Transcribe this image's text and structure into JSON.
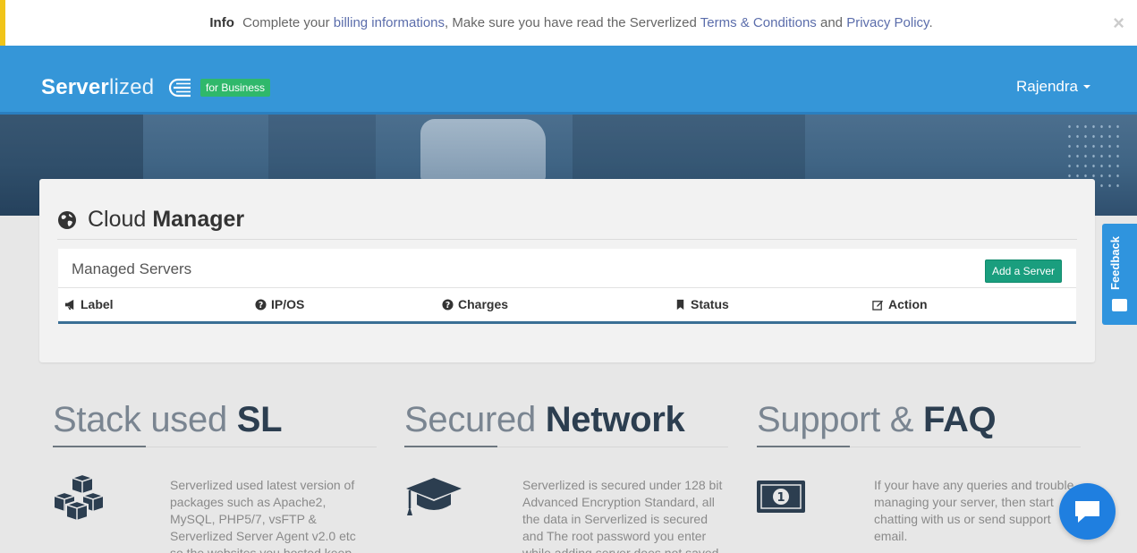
{
  "infobar": {
    "label": "Info",
    "text1": "Complete your",
    "link1": "billing informations",
    "text2": ", Make sure you have read the Serverlized",
    "link2": "Terms & Conditions",
    "text3": "and",
    "link3": "Privacy Policy",
    "text4": ".",
    "close": "×"
  },
  "header": {
    "logo_bold": "Server",
    "logo_light": "lized",
    "badge": "for Business",
    "user": "Rajendra",
    "color": "#3596d8"
  },
  "card": {
    "title_light": "Cloud",
    "title_bold": "Manager",
    "panel_title": "Managed Servers",
    "add_button": "Add a Server",
    "columns": [
      {
        "label": "Label",
        "icon": "bullhorn-icon"
      },
      {
        "label": "IP/OS",
        "icon": "question-circle-icon"
      },
      {
        "label": "Charges",
        "icon": "question-circle-icon"
      },
      {
        "label": "Status",
        "icon": "bookmark-icon"
      },
      {
        "label": "Action",
        "icon": "edit-icon"
      }
    ]
  },
  "feedback": {
    "label": "Feedback"
  },
  "features": [
    {
      "title_light": "Stack used",
      "title_bold": "SL",
      "icon": "cubes-icon",
      "text": "Serverlized used latest version of packages such as Apache2, MySQL, PHP5/7, vsFTP & Serverlized Server Agent v2.0 etc so the websites you hosted keep optimized and secured"
    },
    {
      "title_light": "Secured",
      "title_bold": "Network",
      "icon": "graduation-cap-icon",
      "text": "Serverlized is secured under 128 bit Advanced Encryption Standard, all the data in Serverlized is secured and The root password you enter while adding server does not saved"
    },
    {
      "title_light": "Support &",
      "title_bold": "FAQ",
      "icon": "money-icon",
      "text": "If your have any queries and trouble managing your server, then start chatting with us or send support email."
    }
  ],
  "chat": {
    "icon": "chat-bubble-icon"
  }
}
